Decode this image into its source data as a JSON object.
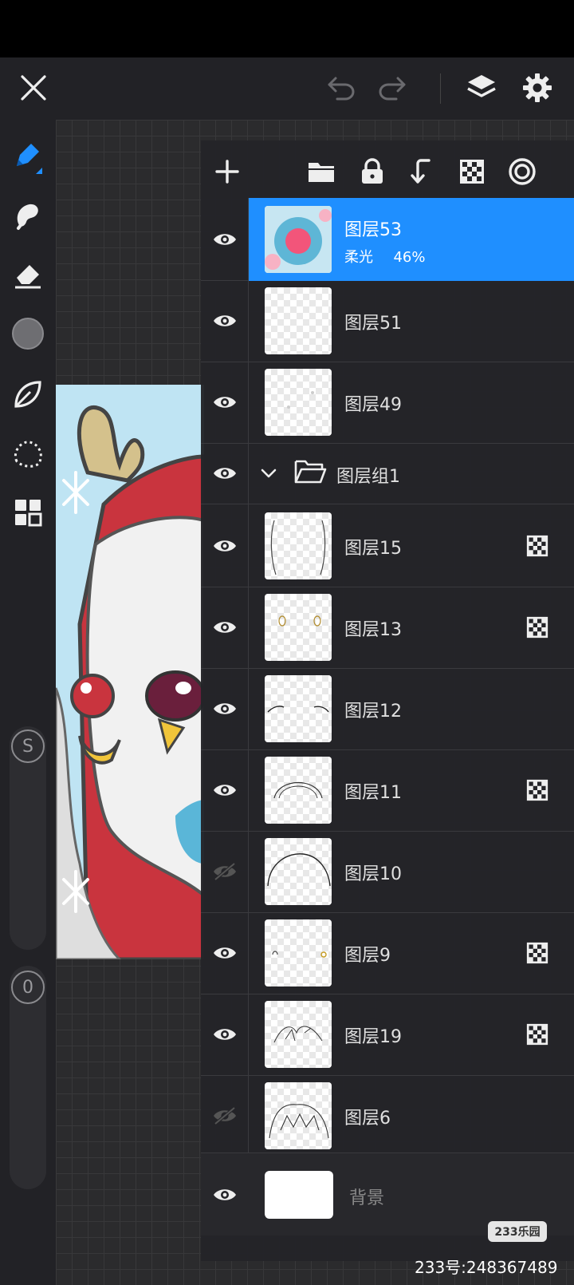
{
  "toolbar": {
    "close_icon": "close-icon",
    "undo_icon": "undo-icon",
    "redo_icon": "redo-icon",
    "layers_icon": "layers-icon",
    "settings_icon": "gear-icon"
  },
  "left_tools": [
    {
      "name": "brush-tool",
      "icon": "pen-icon",
      "active": true
    },
    {
      "name": "smudge-tool",
      "icon": "smudge-icon"
    },
    {
      "name": "eraser-tool",
      "icon": "eraser-icon"
    },
    {
      "name": "color-tool",
      "icon": "color-circle-icon",
      "color": "#6e6e72"
    },
    {
      "name": "leaf-tool",
      "icon": "leaf-icon"
    },
    {
      "name": "lasso-tool",
      "icon": "lasso-icon"
    },
    {
      "name": "grid-tool",
      "icon": "grid-icon"
    }
  ],
  "sliders": {
    "size_knob": "S",
    "opacity_knob": "0"
  },
  "layer_toolbar": {
    "add_icon": "plus-icon",
    "folder_icon": "folder-icon",
    "lock_icon": "lock-icon",
    "merge_down_icon": "arrow-down-left-icon",
    "checker_icon": "checker-icon",
    "target_icon": "target-icon"
  },
  "layers": [
    {
      "name": "图层53",
      "blend": "柔光",
      "opacity": "46%",
      "selected": true,
      "visible": true,
      "clip": false
    },
    {
      "name": "图层51",
      "visible": true,
      "clip": false
    },
    {
      "name": "图层49",
      "visible": true,
      "clip": false
    }
  ],
  "group": {
    "name": "图层组1",
    "visible": true,
    "expanded": true
  },
  "group_layers": [
    {
      "name": "图层15",
      "visible": true,
      "clip": true
    },
    {
      "name": "图层13",
      "visible": true,
      "clip": true
    },
    {
      "name": "图层12",
      "visible": true,
      "clip": false
    },
    {
      "name": "图层11",
      "visible": true,
      "clip": true
    },
    {
      "name": "图层10",
      "visible": false,
      "clip": false
    },
    {
      "name": "图层9",
      "visible": true,
      "clip": true
    },
    {
      "name": "图层19",
      "visible": true,
      "clip": true
    },
    {
      "name": "图层6",
      "visible": false,
      "clip": false
    }
  ],
  "background_layer": {
    "name": "背景",
    "visible": true
  },
  "watermark": {
    "logo": "233乐园",
    "text": "233号:248367489"
  },
  "colors": {
    "accent": "#1f8fff",
    "panel": "#242428",
    "toolbar": "#222226"
  }
}
